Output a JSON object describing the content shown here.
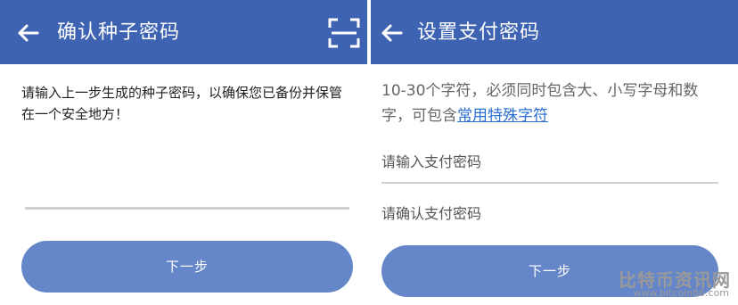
{
  "left_screen": {
    "title": "确认种子密码",
    "icons": {
      "back": "arrow-left-icon",
      "scan": "scan-icon"
    },
    "description": "请输入上一步生成的种子密码，以确保您已备份并保管在一个安全地方！",
    "next_button": "下一步"
  },
  "right_screen": {
    "title": "设置支付密码",
    "icons": {
      "back": "arrow-left-icon"
    },
    "hint_prefix": "10-30个字符，必须同时包含大、小写字母和数字，可包含",
    "hint_link": "常用特殊字符",
    "password_placeholder": "请输入支付密码",
    "confirm_placeholder": "请确认支付密码",
    "next_button": "下一步"
  },
  "watermark": {
    "text": "比特币资讯网",
    "url": "www.bitcoin86.com"
  },
  "colors": {
    "header": "#3f63b3",
    "button": "#6586c8",
    "link": "#2b6fd0",
    "background": "#ffffff"
  }
}
